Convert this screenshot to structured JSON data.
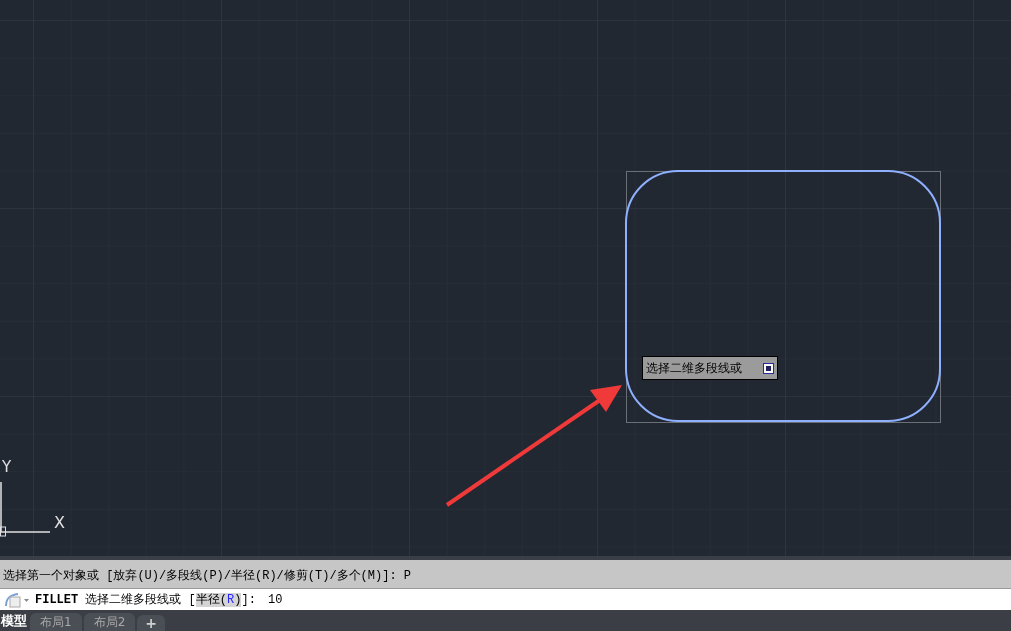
{
  "canvas": {
    "ucs": {
      "y_label": "Y",
      "x_label": "X"
    },
    "tooltip": {
      "text": "选择二维多段线或"
    }
  },
  "command_history": [
    {
      "text": "选择第一个对象或 [放弃(U)/多段线(P)/半径(R)/修剪(T)/多个(M)]: P"
    }
  ],
  "command_line": {
    "parts": [
      {
        "kind": "command",
        "text": "FILLET"
      },
      {
        "kind": "plain",
        "text": " 选择二维多段线或 ["
      },
      {
        "kind": "option",
        "text": "半径("
      },
      {
        "kind": "key",
        "text": "R"
      },
      {
        "kind": "option",
        "text": ")"
      },
      {
        "kind": "plain",
        "text": "]: "
      }
    ],
    "value": "10"
  },
  "tabs": [
    {
      "label": "模型",
      "selected": true
    },
    {
      "label": "布局1",
      "selected": false
    },
    {
      "label": "布局2",
      "selected": false
    }
  ],
  "add_tab": {
    "label": "+"
  }
}
